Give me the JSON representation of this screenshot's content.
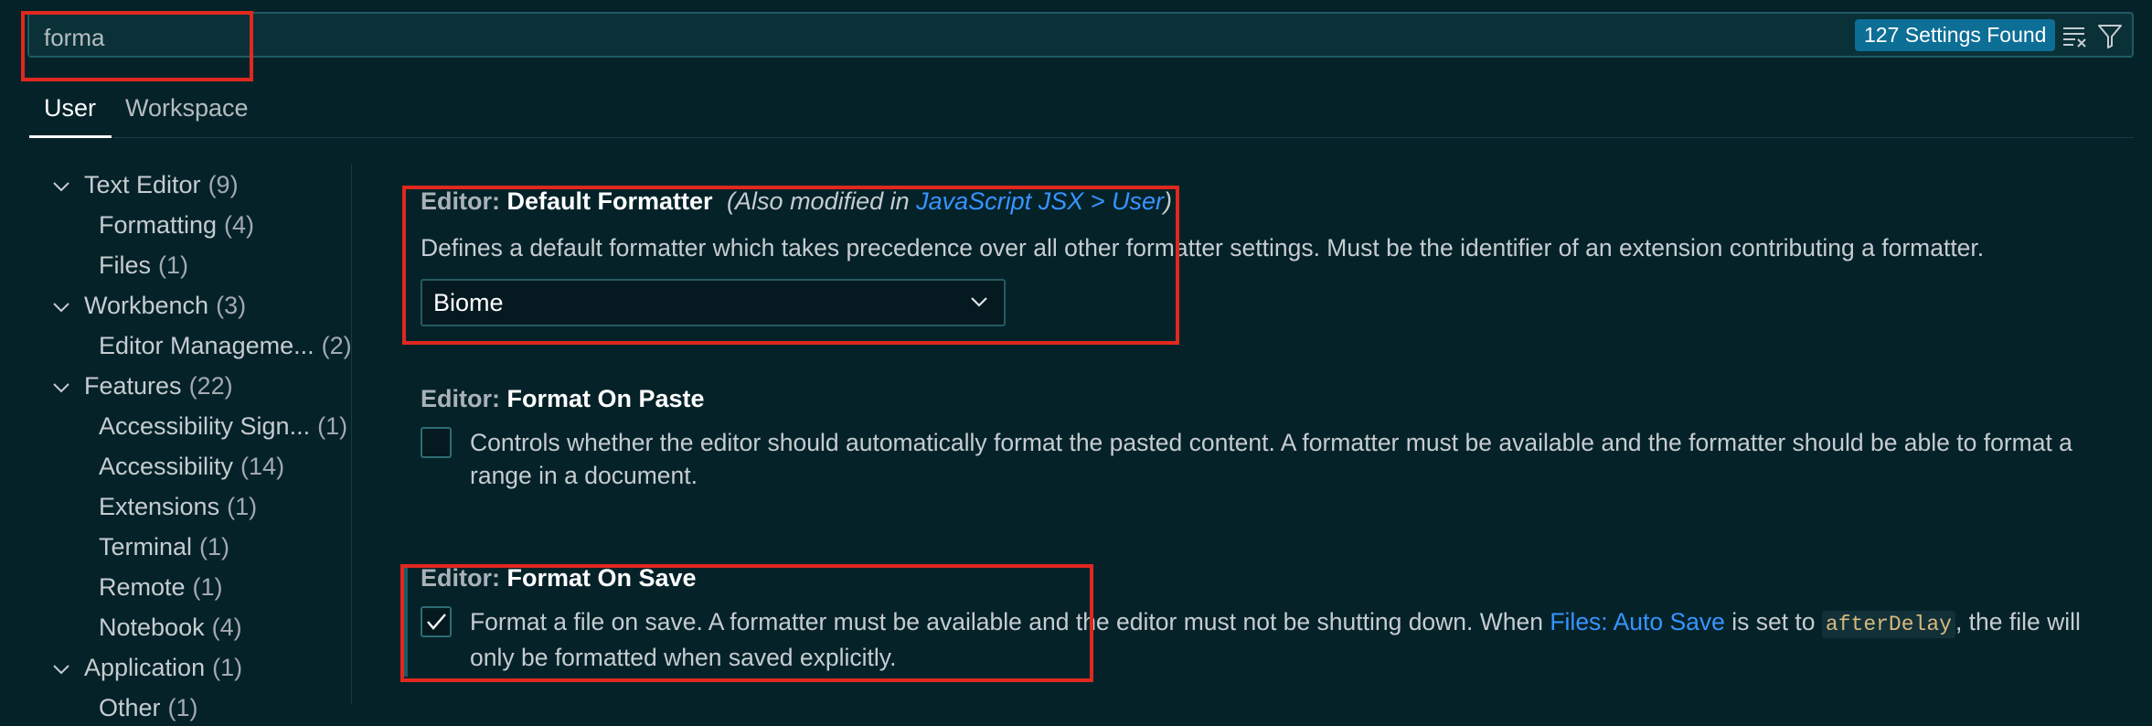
{
  "search": {
    "value": "forma",
    "results_badge": "127 Settings Found",
    "clear_icon": "clear-filter-icon",
    "filter_icon": "filter-icon"
  },
  "tabs": [
    {
      "label": "User",
      "active": true
    },
    {
      "label": "Workspace",
      "active": false
    }
  ],
  "toc": [
    {
      "label": "Text Editor",
      "count": "(9)",
      "expanded": true,
      "level": 0
    },
    {
      "label": "Formatting",
      "count": "(4)",
      "level": 1
    },
    {
      "label": "Files",
      "count": "(1)",
      "level": 1
    },
    {
      "label": "Workbench",
      "count": "(3)",
      "expanded": true,
      "level": 0
    },
    {
      "label": "Editor Manageme...",
      "count": "(2)",
      "level": 1
    },
    {
      "label": "Features",
      "count": "(22)",
      "expanded": true,
      "level": 0
    },
    {
      "label": "Accessibility Sign...",
      "count": "(1)",
      "level": 1
    },
    {
      "label": "Accessibility",
      "count": "(14)",
      "level": 1
    },
    {
      "label": "Extensions",
      "count": "(1)",
      "level": 1
    },
    {
      "label": "Terminal",
      "count": "(1)",
      "level": 1
    },
    {
      "label": "Remote",
      "count": "(1)",
      "level": 1
    },
    {
      "label": "Notebook",
      "count": "(4)",
      "level": 1
    },
    {
      "label": "Application",
      "count": "(1)",
      "expanded": true,
      "level": 0
    },
    {
      "label": "Other",
      "count": "(1)",
      "level": 1
    }
  ],
  "settings": {
    "default_formatter": {
      "category": "Editor: ",
      "name": "Default Formatter",
      "modified_prefix": "(Also modified in ",
      "modified_link": "JavaScript JSX > User",
      "modified_suffix": ")",
      "description": "Defines a default formatter which takes precedence over all other formatter settings. Must be the identifier of an extension contributing a formatter.",
      "value": "Biome"
    },
    "format_on_paste": {
      "category": "Editor: ",
      "name": "Format On Paste",
      "description": "Controls whether the editor should automatically format the pasted content. A formatter must be available and the formatter should be able to format a range in a document.",
      "checked": false
    },
    "format_on_save": {
      "category": "Editor: ",
      "name": "Format On Save",
      "desc_part1": "Format a file on save. A formatter must be available and the editor must not be shutting down. When ",
      "desc_link": "Files: Auto Save",
      "desc_part2": " is set to ",
      "desc_code": "afterDelay",
      "desc_part3": ", the file will only be formatted when saved explicitly.",
      "checked": true
    }
  },
  "colors": {
    "background": "#052229",
    "accent": "#3794ff",
    "badge": "#0d6e96",
    "highlight_box": "#e1281f"
  }
}
